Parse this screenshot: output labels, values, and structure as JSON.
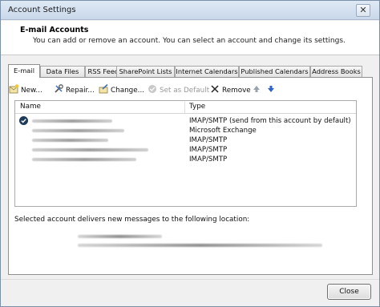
{
  "window": {
    "title": "Account Settings",
    "close_glyph": "✕"
  },
  "header": {
    "title": "E-mail Accounts",
    "subtitle": "You can add or remove an account. You can select an account and change its settings."
  },
  "tabs": [
    {
      "label": "E-mail",
      "active": true
    },
    {
      "label": "Data Files",
      "active": false
    },
    {
      "label": "RSS Feeds",
      "active": false
    },
    {
      "label": "SharePoint Lists",
      "active": false
    },
    {
      "label": "Internet Calendars",
      "active": false
    },
    {
      "label": "Published Calendars",
      "active": false
    },
    {
      "label": "Address Books",
      "active": false
    }
  ],
  "toolbar": {
    "new_label": "New...",
    "repair_label": "Repair...",
    "change_label": "Change...",
    "set_default_label": "Set as Default",
    "remove_label": "Remove",
    "up_icon": "arrow-up-icon",
    "down_icon": "arrow-down-icon"
  },
  "accounts_table": {
    "col_name": "Name",
    "col_type": "Type",
    "rows": [
      {
        "type": "IMAP/SMTP (send from this account by default)",
        "is_default": true
      },
      {
        "type": "Microsoft Exchange",
        "is_default": false
      },
      {
        "type": "IMAP/SMTP",
        "is_default": false
      },
      {
        "type": "IMAP/SMTP",
        "is_default": false
      },
      {
        "type": "IMAP/SMTP",
        "is_default": false
      }
    ]
  },
  "delivery": {
    "label": "Selected account delivers new messages to the following location:"
  },
  "footer": {
    "close_label": "Close"
  },
  "colors": {
    "title_bar": "#c9d8ea",
    "default_badge": "#1d3a5c",
    "remove_x": "#222222",
    "arrow_up_disabled": "#9aa3ad",
    "arrow_down": "#2f63c9"
  }
}
